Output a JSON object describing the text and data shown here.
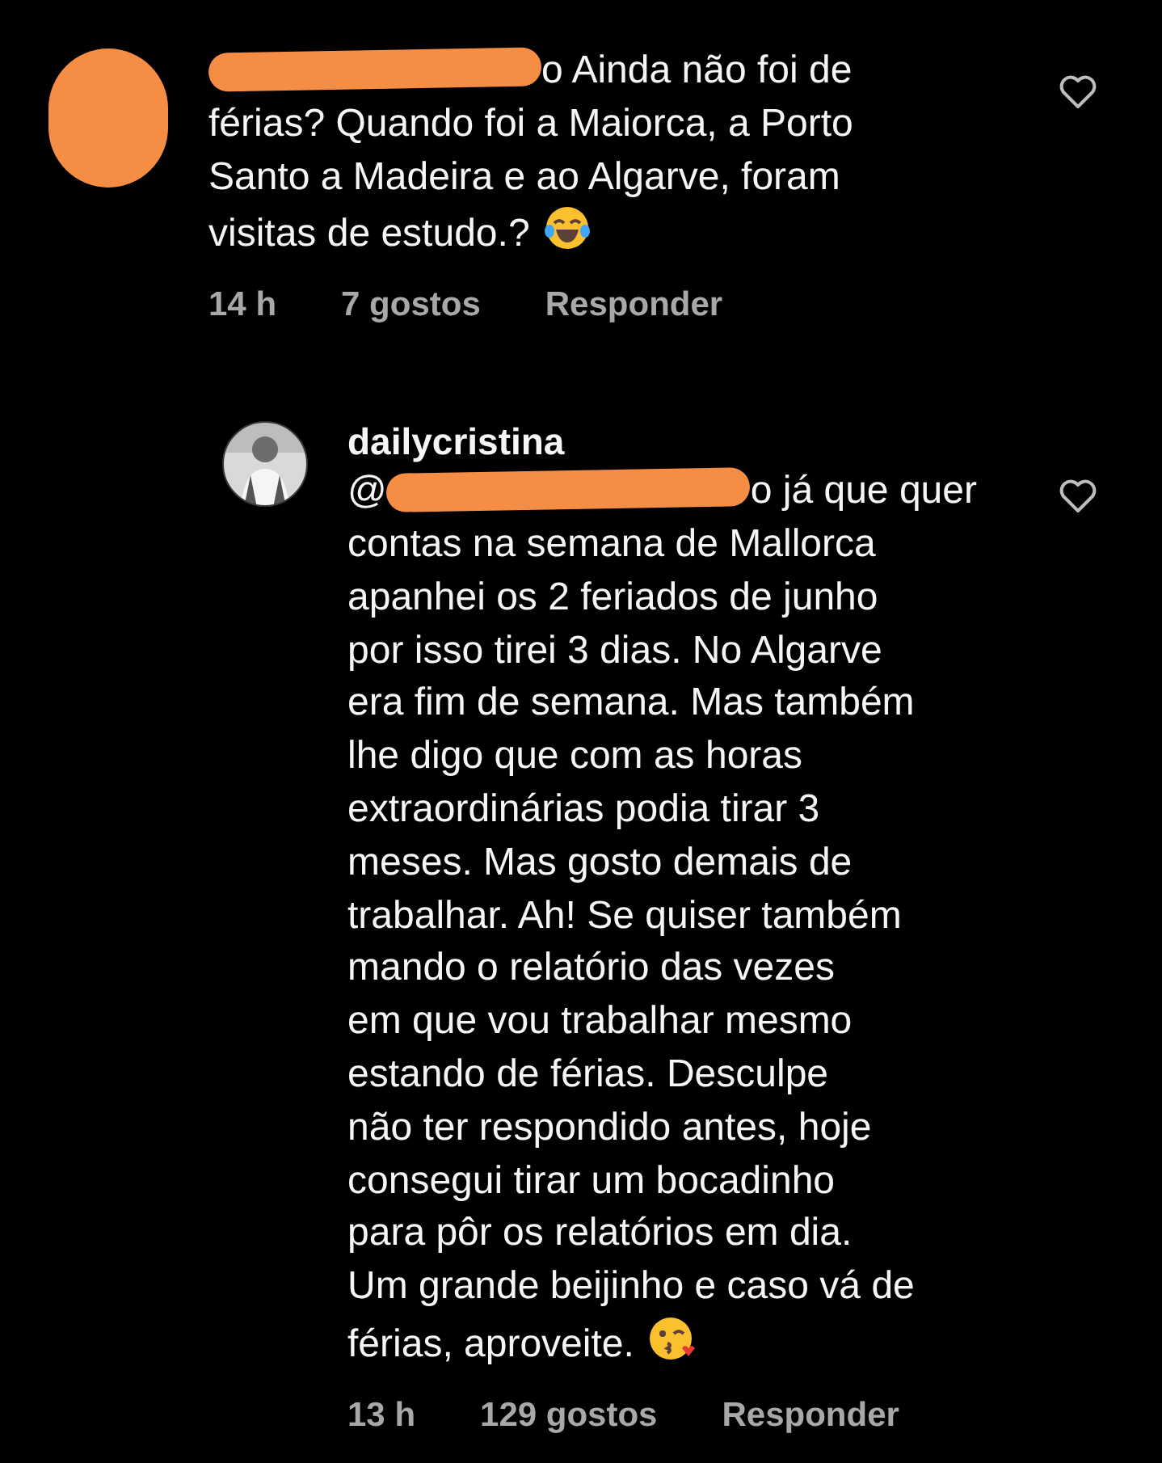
{
  "comments": [
    {
      "avatar": {
        "kind": "redacted"
      },
      "username_redacted": true,
      "lines": [
        "o Ainda não foi de",
        "férias? Quando foi a Maiorca, a Porto",
        "Santo a Madeira e ao Algarve, foram",
        "visitas de estudo.?"
      ],
      "emoji": {
        "kind": "laughing"
      },
      "time": "14 h",
      "likes": "7 gostos",
      "reply": "Responder",
      "liked": false
    },
    {
      "username": "dailycristina",
      "lead": "@",
      "lines": [
        "o já que quer",
        "contas na semana de Mallorca",
        "apanhei os 2 feriados de junho",
        "por isso tirei 3 dias. No Algarve",
        "era fim de semana. Mas também",
        "lhe digo que com as horas",
        "extraordinárias podia tirar 3",
        "meses. Mas gosto demais de",
        "trabalhar. Ah! Se quiser também",
        "mando o relatório das vezes",
        "em que vou trabalhar mesmo",
        "estando de férias. Desculpe",
        "não ter respondido antes, hoje",
        "consegui tirar um bocadinho",
        "para pôr os relatórios em dia.",
        "Um grande beijinho e caso vá de",
        "férias, aproveite."
      ],
      "emoji": {
        "kind": "kiss"
      },
      "time": "13 h",
      "likes": "129 gostos",
      "reply": "Responder",
      "liked": false
    }
  ]
}
